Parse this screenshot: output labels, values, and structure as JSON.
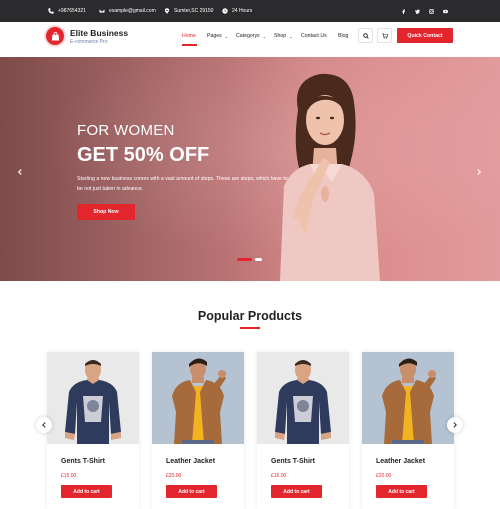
{
  "topbar": {
    "phone": "+987654321",
    "email": "example@gmail.com",
    "address": "Sumter,SC 29150",
    "hours": "24 Hours",
    "social": [
      "facebook-icon",
      "twitter-icon",
      "instagram-icon",
      "youtube-icon"
    ]
  },
  "header": {
    "brand_name": "Elite Business",
    "brand_sub": "E-commerce Pro",
    "nav": [
      {
        "label": "Home",
        "dropdown": false
      },
      {
        "label": "Pages",
        "dropdown": true
      },
      {
        "label": "Categorys",
        "dropdown": true
      },
      {
        "label": "Shop",
        "dropdown": true
      },
      {
        "label": "Contact Us",
        "dropdown": false
      },
      {
        "label": "Blog",
        "dropdown": false
      }
    ],
    "active_nav": "Home",
    "cta_label": "Quick Contact"
  },
  "hero": {
    "title_line1": "FOR WOMEN",
    "title_line2": "GET 50% OFF",
    "text": "Starting a new business comes with a vast amount of steps. These are steps, which have to be not just taken in advance.",
    "button_label": "Shop Now",
    "slides_total": 2,
    "slide_active": 1
  },
  "products": {
    "title": "Popular Products",
    "items": [
      {
        "name": "Gents T-Shirt",
        "price": "£15.00",
        "button": "Add to cart"
      },
      {
        "name": "Leather Jacket",
        "price": "£20.00",
        "button": "Add to cart"
      },
      {
        "name": "Gents T-Shirt",
        "price": "£15.00",
        "button": "Add to cart"
      },
      {
        "name": "Leather Jacket",
        "price": "£20.00",
        "button": "Add to cart"
      }
    ]
  },
  "colors": {
    "accent": "#e3262e",
    "topbar": "#2b2b2e",
    "brand_sub": "#6a7fb0"
  }
}
